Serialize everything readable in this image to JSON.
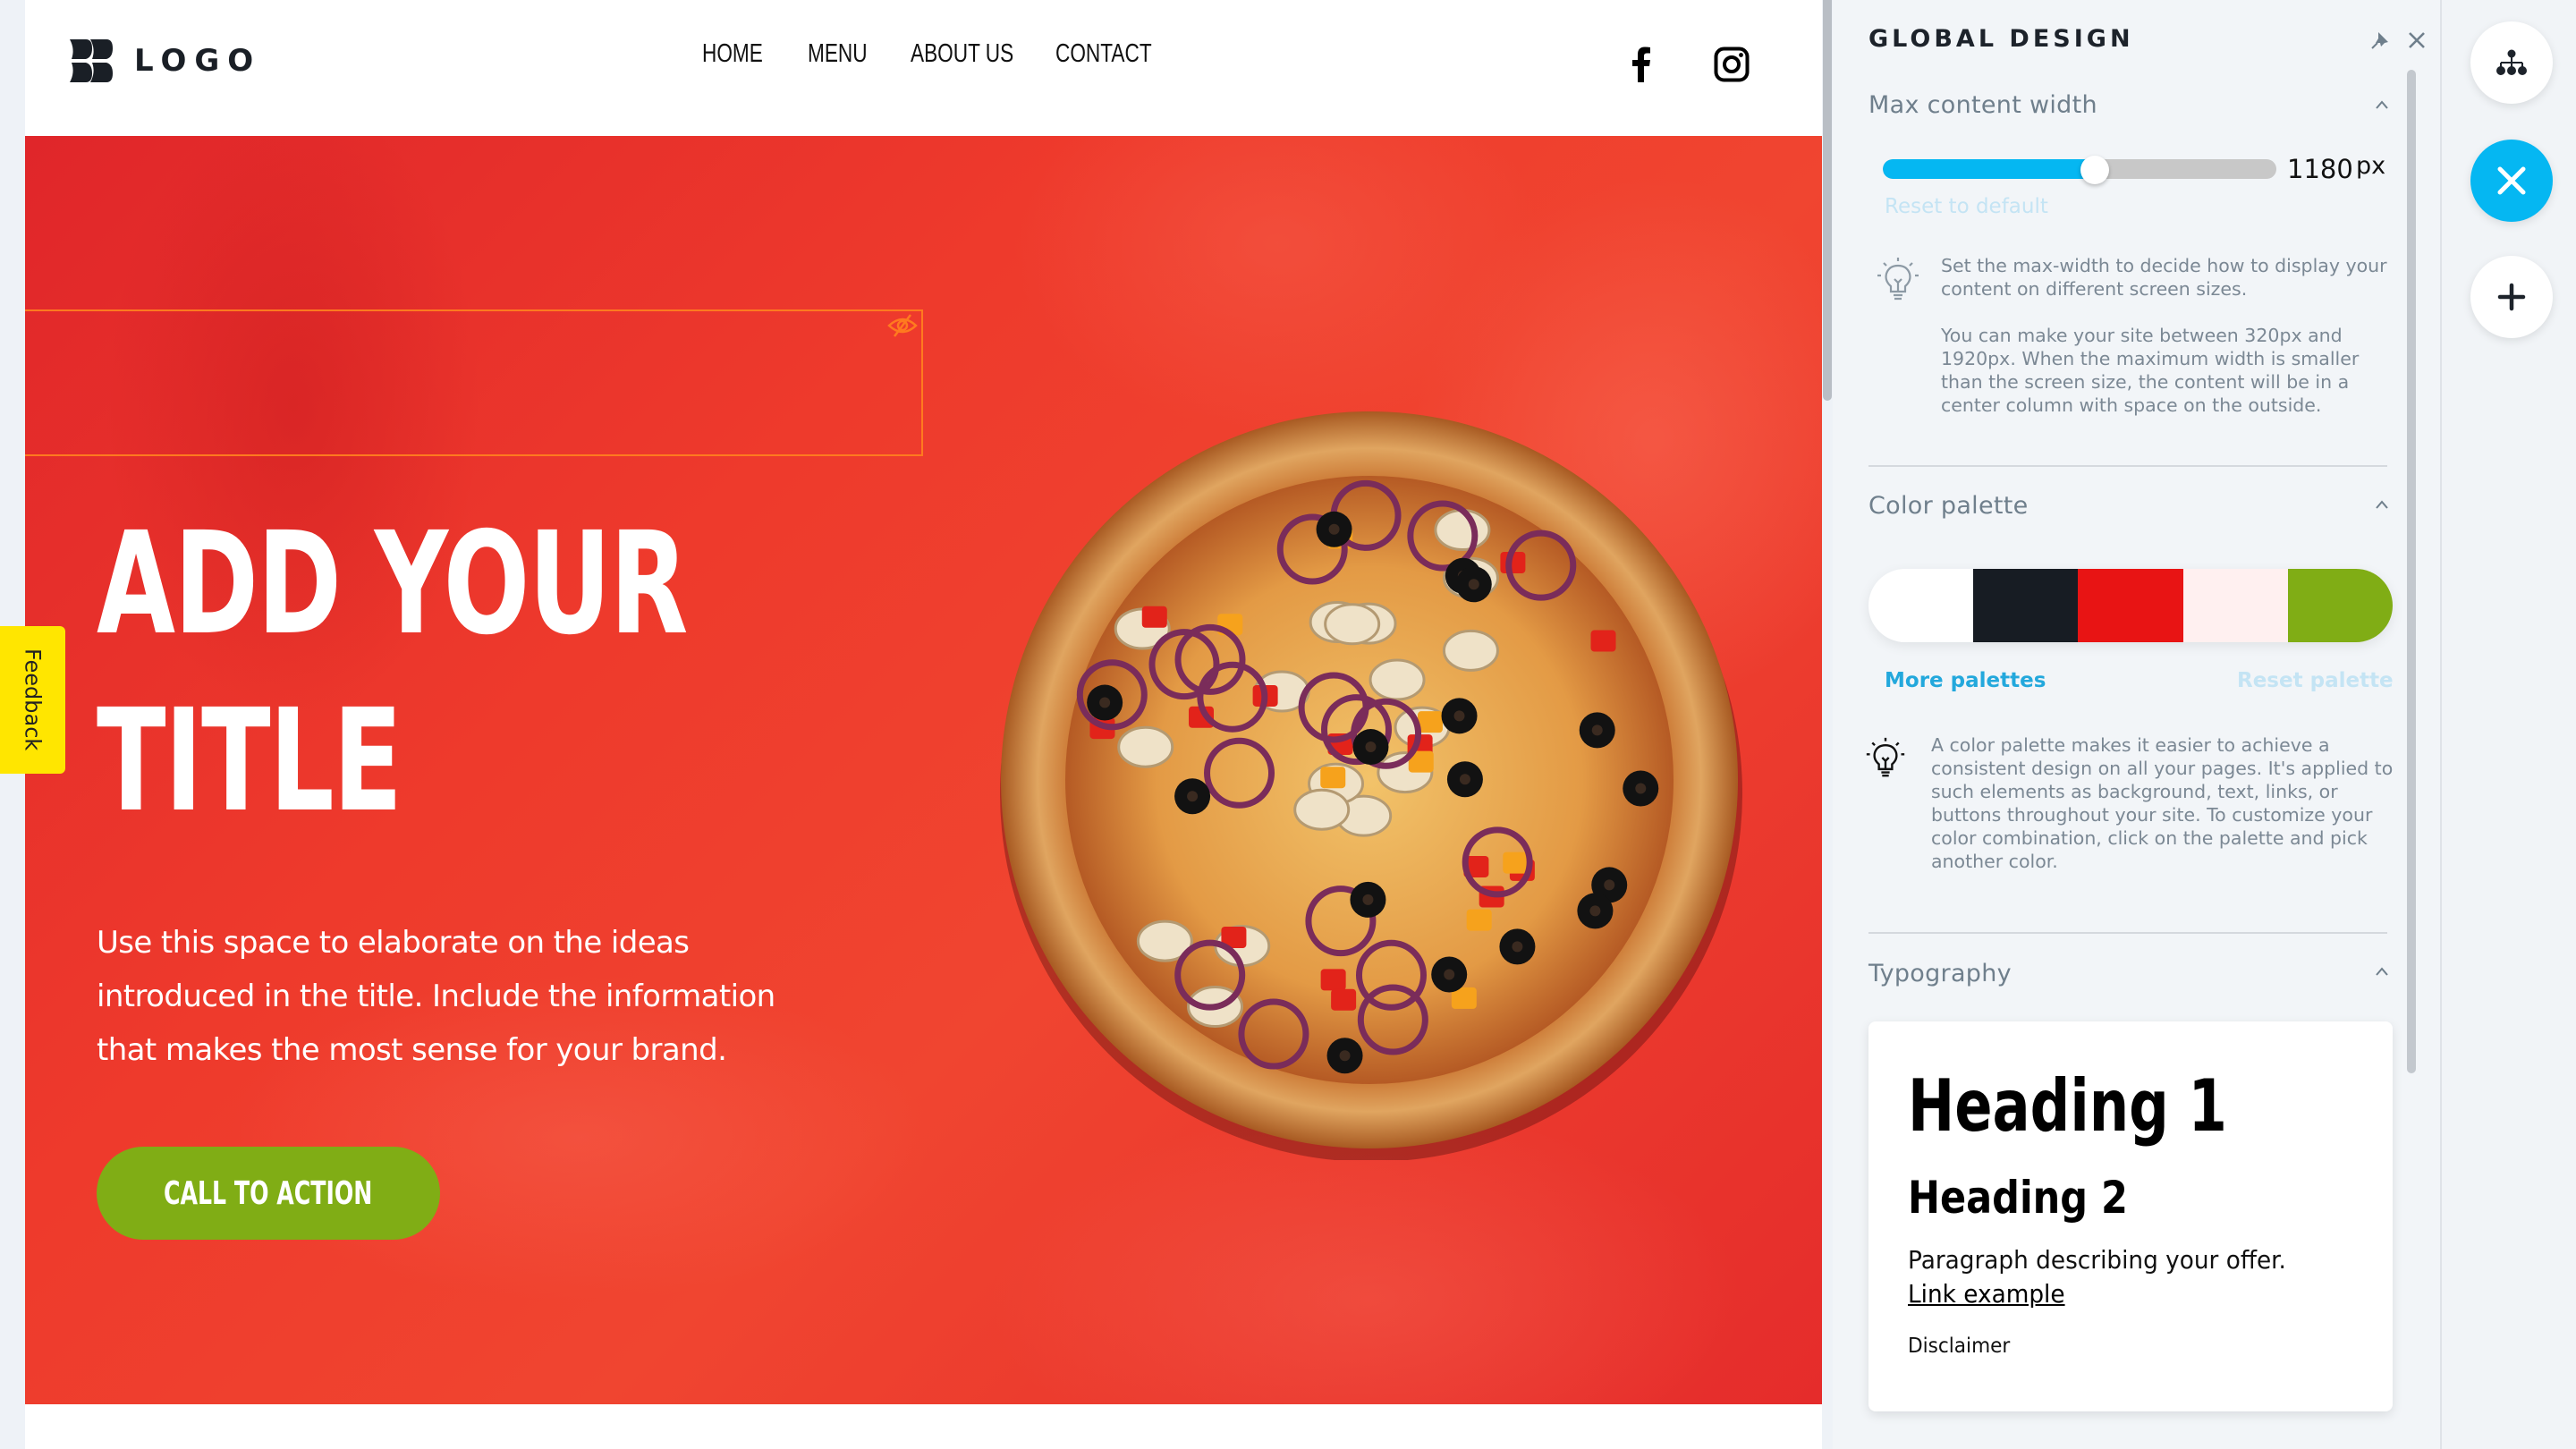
{
  "site": {
    "logo_text": "LOGO",
    "nav": [
      "HOME",
      "MENU",
      "ABOUT US",
      "CONTACT"
    ],
    "social": [
      "facebook-icon",
      "instagram-icon"
    ],
    "hero": {
      "title_lines": [
        "ADD YOUR",
        "TITLE"
      ],
      "text": "Use this space to elaborate on the ideas introduced in the title. Include the information that makes the most sense for your brand.",
      "cta_label": "CALL TO ACTION",
      "hidden_element_icon": "eye-off-icon"
    },
    "feedback_label": "Feedback"
  },
  "panel": {
    "title": "GLOBAL DESIGN",
    "pin_icon": "pin-icon",
    "close_icon": "close-icon",
    "max_width": {
      "title": "Max content width",
      "value": 1180,
      "value_text": "1180",
      "unit": "px",
      "min": 320,
      "max": 1920,
      "reset_label": "Reset to default",
      "help_1": "Set the max-width to decide how to display your content on different screen sizes.",
      "help_2": "You can make your site between 320px and 1920px. When the maximum width is smaller than the screen size, the content will be in a center column with space on the outside."
    },
    "color_palette": {
      "title": "Color palette",
      "swatches": [
        "#ffffff",
        "#171c23",
        "#e81414",
        "#fff0f0",
        "#80ad15"
      ],
      "more_label": "More palettes",
      "reset_label": "Reset palette",
      "help": "A color palette makes it easier to achieve a consistent design on all your pages. It's applied to such elements as background, text, links, or buttons throughout your site. To customize your color combination, click on the palette and pick another color."
    },
    "typography": {
      "title": "Typography",
      "heading1": "Heading 1",
      "heading2": "Heading 2",
      "paragraph": "Paragraph describing your offer.",
      "link": "Link example",
      "disclaimer": "Disclaimer"
    }
  },
  "rail": {
    "buttons": [
      "sitemap-icon",
      "design-tools-icon",
      "add-icon"
    ]
  },
  "colors": {
    "accent": "#05b7f2",
    "cta": "#80ad15",
    "hero_red": "#e8302a",
    "feedback": "#ffe600"
  }
}
